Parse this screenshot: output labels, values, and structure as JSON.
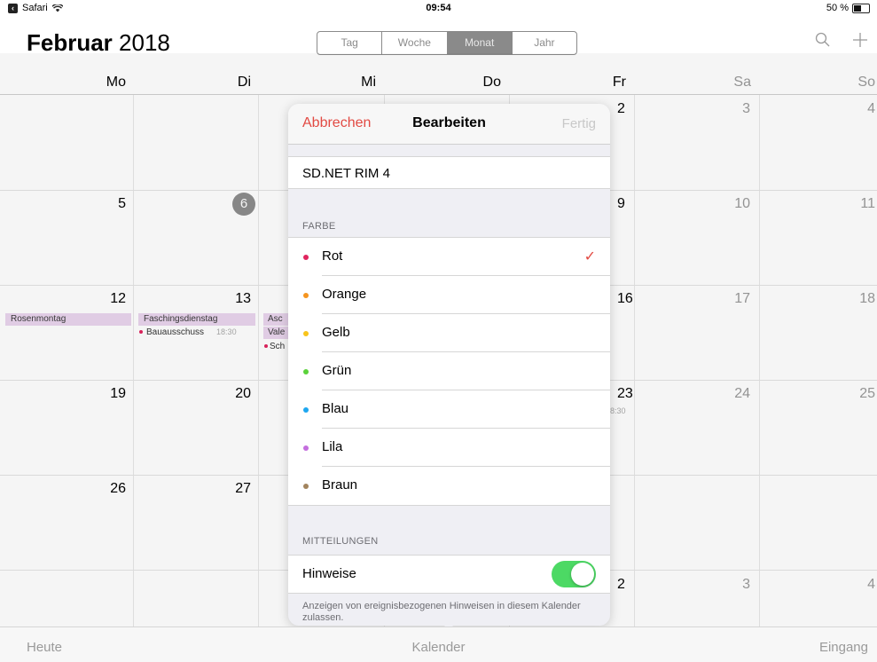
{
  "status": {
    "app": "Safari",
    "time": "09:54",
    "battery": "50 %"
  },
  "header": {
    "month": "Februar",
    "year": " 2018",
    "tabs": [
      "Tag",
      "Woche",
      "Monat",
      "Jahr"
    ],
    "active_tab": "Monat"
  },
  "weekdays": [
    "Mo",
    "Di",
    "Mi",
    "Do",
    "Fr",
    "Sa",
    "So"
  ],
  "calendar": {
    "visible_days": [
      "2",
      "3",
      "4",
      "5",
      "6",
      "9",
      "10",
      "11",
      "12",
      "13",
      "16",
      "17",
      "18",
      "19",
      "20",
      "23",
      "24",
      "25",
      "26",
      "27",
      "2",
      "3",
      "4"
    ],
    "events": {
      "rosenmontag": "Rosenmontag",
      "faschingsdienstag": "Faschingsdienstag",
      "bauausschuss": "Bauausschuss",
      "bauausschuss_time": "18:30",
      "asc": "Asc",
      "vale": "Vale",
      "sch": "Sch",
      "fr23_time": "8:30"
    }
  },
  "popover": {
    "cancel": "Abbrechen",
    "title": "Bearbeiten",
    "done": "Fertig",
    "calendar_name": "SD.NET RIM 4",
    "color_header": "FARBE",
    "colors": [
      {
        "label": "Rot",
        "hex": "#e0245e",
        "selected": true
      },
      {
        "label": "Orange",
        "hex": "#f5951f"
      },
      {
        "label": "Gelb",
        "hex": "#f8c41b"
      },
      {
        "label": "Grün",
        "hex": "#5ad23a"
      },
      {
        "label": "Blau",
        "hex": "#1ea7f0"
      },
      {
        "label": "Lila",
        "hex": "#c46ede"
      },
      {
        "label": "Braun",
        "hex": "#a2845e"
      }
    ],
    "notifications_header": "MITTEILUNGEN",
    "notifications_label": "Hinweise",
    "notifications_on": true,
    "footer": "Anzeigen von ereignisbezogenen Hinweisen in diesem Kalender zulassen."
  },
  "tabbar": {
    "today": "Heute",
    "calendars": "Kalender",
    "inbox": "Eingang"
  }
}
